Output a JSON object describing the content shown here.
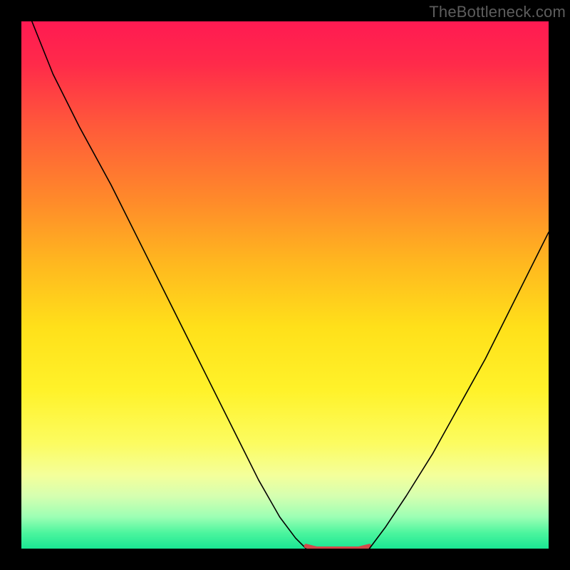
{
  "watermark": "TheBottleneck.com",
  "chart_data": {
    "type": "line",
    "title": "",
    "xlabel": "",
    "ylabel": "",
    "xlim": [
      0,
      100
    ],
    "ylim": [
      0,
      100
    ],
    "grid": false,
    "legend": false,
    "background_gradient": [
      {
        "pos": 0.0,
        "color": "#ff1a52"
      },
      {
        "pos": 0.08,
        "color": "#ff2a4a"
      },
      {
        "pos": 0.2,
        "color": "#ff5a3a"
      },
      {
        "pos": 0.34,
        "color": "#ff8a2a"
      },
      {
        "pos": 0.46,
        "color": "#ffb81f"
      },
      {
        "pos": 0.58,
        "color": "#ffe01a"
      },
      {
        "pos": 0.7,
        "color": "#fff22a"
      },
      {
        "pos": 0.8,
        "color": "#fcfc60"
      },
      {
        "pos": 0.86,
        "color": "#f4ff9a"
      },
      {
        "pos": 0.9,
        "color": "#d6ffb0"
      },
      {
        "pos": 0.94,
        "color": "#9cffb4"
      },
      {
        "pos": 0.97,
        "color": "#4cf59e"
      },
      {
        "pos": 1.0,
        "color": "#1ae693"
      }
    ],
    "series": [
      {
        "name": "left-curve",
        "color": "#000000",
        "x": [
          2,
          6,
          11,
          17,
          23,
          29,
          35,
          41,
          45,
          49,
          52,
          54
        ],
        "y": [
          100,
          90,
          80,
          69,
          57,
          45,
          33,
          21,
          13,
          6,
          2,
          0
        ]
      },
      {
        "name": "bottom-flat",
        "color": "#d24a4a",
        "x": [
          54,
          56,
          58,
          60,
          62,
          64,
          66
        ],
        "y": [
          0.5,
          0,
          0,
          0,
          0,
          0,
          0.5
        ]
      },
      {
        "name": "right-curve",
        "color": "#000000",
        "x": [
          66,
          69,
          73,
          78,
          83,
          88,
          93,
          98,
          100
        ],
        "y": [
          0,
          4,
          10,
          18,
          27,
          36,
          46,
          56,
          60
        ]
      }
    ]
  }
}
